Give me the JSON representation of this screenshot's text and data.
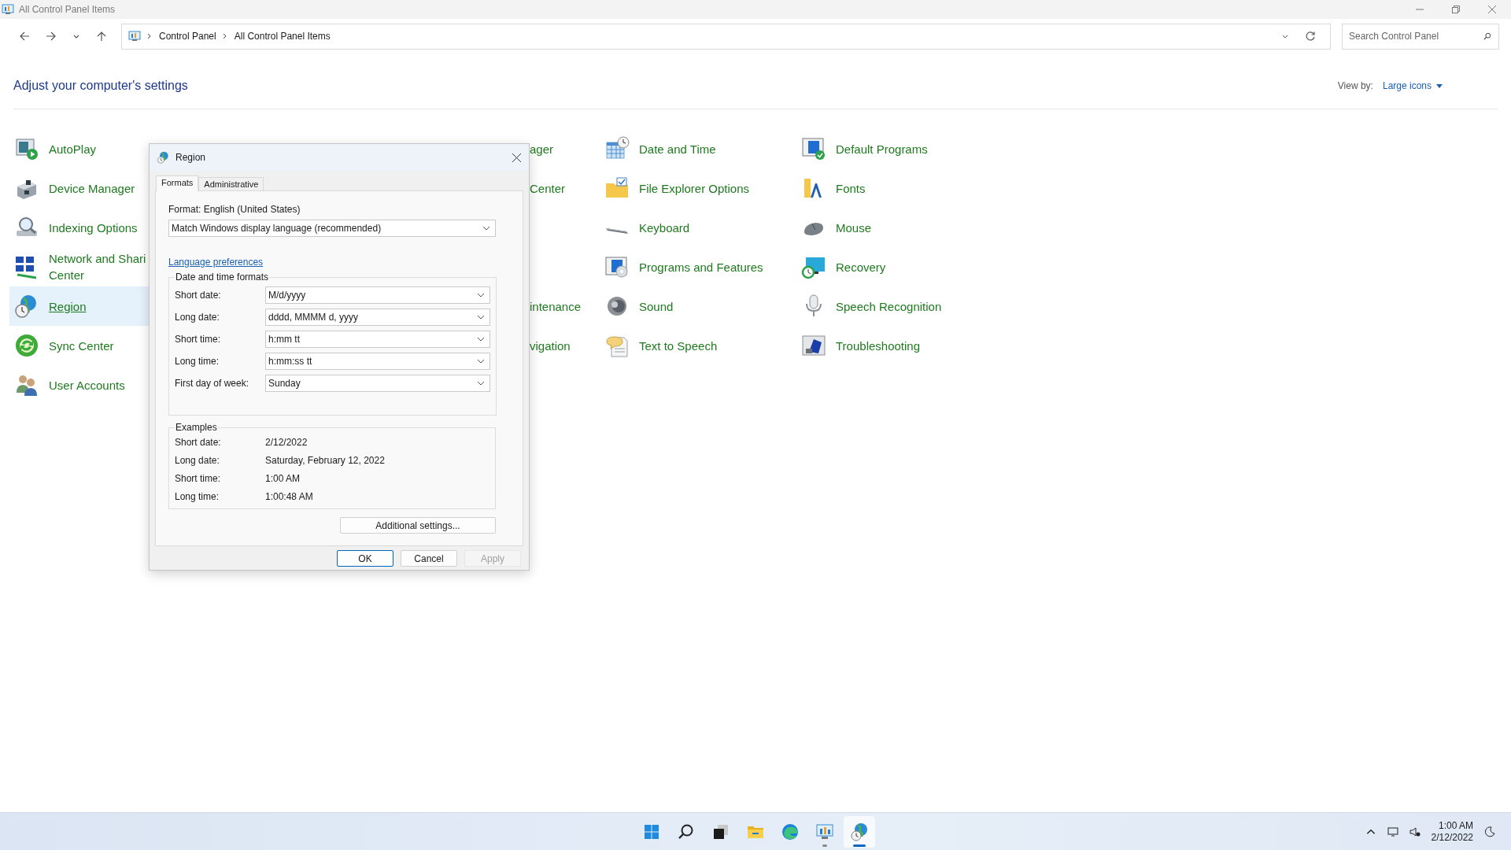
{
  "window": {
    "title": "All Control Panel Items"
  },
  "address_bar": {
    "breadcrumbs": [
      "Control Panel",
      "All Control Panel Items"
    ]
  },
  "search": {
    "placeholder": "Search Control Panel"
  },
  "header": {
    "title": "Adjust your computer's settings",
    "view_by_label": "View by:",
    "view_by_value": "Large icons"
  },
  "columns": [
    [
      {
        "label": "AutoPlay",
        "selected": false
      },
      {
        "label": "Device Manager",
        "selected": false
      },
      {
        "label": "Indexing Options",
        "selected": false
      },
      {
        "label": "Network and Shari\nCenter",
        "selected": false
      },
      {
        "label": "Region",
        "selected": true
      },
      {
        "label": "Sync Center",
        "selected": false
      },
      {
        "label": "User Accounts",
        "selected": false
      }
    ],
    [],
    [
      {
        "label": "ager",
        "selected": false
      },
      {
        "label": "Center",
        "selected": false
      },
      null,
      null,
      {
        "label": "intenance",
        "selected": false
      },
      {
        "label": "vigation",
        "selected": false
      }
    ],
    [
      {
        "label": "Date and Time",
        "selected": false
      },
      {
        "label": "File Explorer Options",
        "selected": false
      },
      {
        "label": "Keyboard",
        "selected": false
      },
      {
        "label": "Programs and Features",
        "selected": false
      },
      {
        "label": "Sound",
        "selected": false
      },
      {
        "label": "Text to Speech",
        "selected": false
      }
    ],
    [
      {
        "label": "Default Programs",
        "selected": false
      },
      {
        "label": "Fonts",
        "selected": false
      },
      {
        "label": "Mouse",
        "selected": false
      },
      {
        "label": "Recovery",
        "selected": false
      },
      {
        "label": "Speech Recognition",
        "selected": false
      },
      {
        "label": "Troubleshooting",
        "selected": false
      }
    ]
  ],
  "dialog": {
    "title": "Region",
    "tabs": [
      {
        "label": "Formats",
        "selected": true
      },
      {
        "label": "Administrative",
        "selected": false
      }
    ],
    "format_label": "Format: English (United States)",
    "format_value": "Match Windows display language (recommended)",
    "link": "Language preferences",
    "formats_group": {
      "title": "Date and time formats",
      "rows": [
        {
          "label": "Short date:",
          "value": "M/d/yyyy"
        },
        {
          "label": "Long date:",
          "value": "dddd, MMMM d, yyyy"
        },
        {
          "label": "Short time:",
          "value": "h:mm tt"
        },
        {
          "label": "Long time:",
          "value": "h:mm:ss tt"
        },
        {
          "label": "First day of week:",
          "value": "Sunday"
        }
      ]
    },
    "examples_group": {
      "title": "Examples",
      "rows": [
        {
          "label": "Short date:",
          "value": "2/12/2022"
        },
        {
          "label": "Long date:",
          "value": "Saturday, February 12, 2022"
        },
        {
          "label": "Short time:",
          "value": "1:00 AM"
        },
        {
          "label": "Long time:",
          "value": "1:00:48 AM"
        }
      ]
    },
    "additional_button": "Additional settings...",
    "buttons": [
      {
        "label": "OK",
        "default": true,
        "disabled": false
      },
      {
        "label": "Cancel",
        "default": false,
        "disabled": false
      },
      {
        "label": "Apply",
        "default": false,
        "disabled": true
      }
    ]
  },
  "taskbar": {
    "items": [
      {
        "selected": false,
        "running": false
      },
      {
        "selected": false,
        "running": false
      },
      {
        "selected": false,
        "running": false
      },
      {
        "selected": false,
        "running": false
      },
      {
        "selected": false,
        "running": false
      },
      {
        "selected": false,
        "running": true
      },
      {
        "selected": true,
        "running": true
      }
    ],
    "clock": {
      "time": "1:00 AM",
      "date": "2/12/2022"
    }
  }
}
